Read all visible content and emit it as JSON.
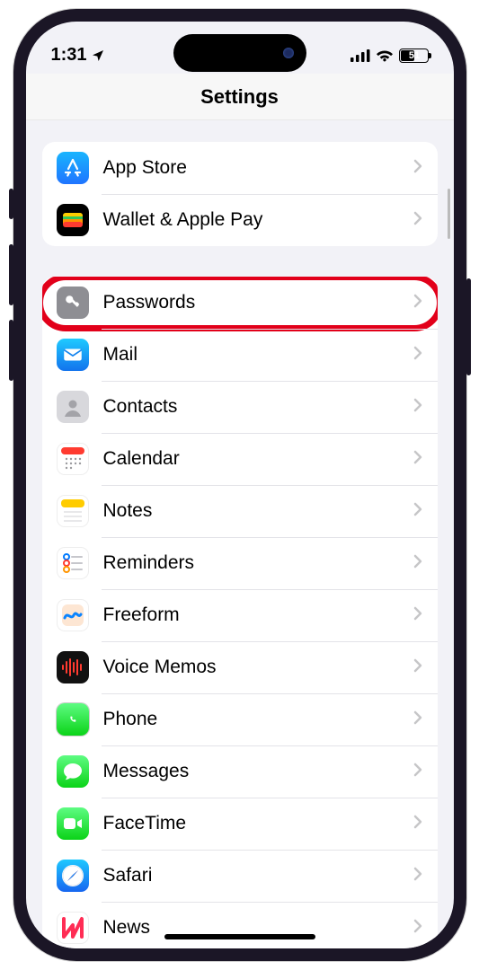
{
  "status": {
    "time": "1:31",
    "battery_pct": "51"
  },
  "nav": {
    "title": "Settings"
  },
  "groups": [
    {
      "id": "store",
      "rows": [
        {
          "name": "app-store",
          "label": "App Store",
          "icon": "appstore",
          "highlighted": false
        },
        {
          "name": "wallet",
          "label": "Wallet & Apple Pay",
          "icon": "wallet",
          "highlighted": false
        }
      ]
    },
    {
      "id": "apps",
      "rows": [
        {
          "name": "passwords",
          "label": "Passwords",
          "icon": "password",
          "highlighted": true
        },
        {
          "name": "mail",
          "label": "Mail",
          "icon": "mail"
        },
        {
          "name": "contacts",
          "label": "Contacts",
          "icon": "contacts"
        },
        {
          "name": "calendar",
          "label": "Calendar",
          "icon": "calendar"
        },
        {
          "name": "notes",
          "label": "Notes",
          "icon": "notes"
        },
        {
          "name": "reminders",
          "label": "Reminders",
          "icon": "reminders"
        },
        {
          "name": "freeform",
          "label": "Freeform",
          "icon": "freeform"
        },
        {
          "name": "voicememo",
          "label": "Voice Memos",
          "icon": "voicememo"
        },
        {
          "name": "phone",
          "label": "Phone",
          "icon": "phone"
        },
        {
          "name": "messages",
          "label": "Messages",
          "icon": "messages"
        },
        {
          "name": "facetime",
          "label": "FaceTime",
          "icon": "facetime"
        },
        {
          "name": "safari",
          "label": "Safari",
          "icon": "safari"
        },
        {
          "name": "news",
          "label": "News",
          "icon": "news"
        }
      ]
    }
  ],
  "icons": {
    "appstore": "<svg width='24' height='24' viewBox='0 0 24 24' fill='none' stroke='#fff' stroke-width='2.2' stroke-linecap='round'><path d='M12 3 L7 13'/><path d='M12 3 L17 13'/><path d='M4 17h5'/><path d='M15 17h5'/><path d='M6.3 20.5 L7.4 18.3'/><path d='M17.7 20.5 L16.6 18.3'/></svg>",
    "wallet": "<svg width='30' height='30' viewBox='0 0 30 30'><rect x='4' y='7' width='22' height='16' rx='3' fill='#3a3a3c'/><rect x='4' y='7' width='22' height='6' rx='3' fill='#ffcc00'/><rect x='4' y='11' width='22' height='5' fill='#34c759'/><rect x='4' y='14' width='22' height='5' fill='#ff9500'/><rect x='4' y='17' width='22' height='6' rx='3' fill='#ff3b30'/></svg>",
    "password": "<svg width='22' height='22' viewBox='0 0 24 24' fill='#fff'><circle cx='8' cy='8' r='4.5'/><rect x='9.5' y='9.5' width='3' height='11' transform='rotate(-45 9.5 9.5)'/><rect x='15' y='13' width='3' height='4' transform='rotate(-45 15 13)'/></svg>",
    "mail": "<svg width='26' height='26' viewBox='0 0 24 24' fill='#fff'><rect x='3' y='6' width='18' height='12' rx='2'/><path d='M3 7l9 6 9-6' fill='none' stroke='#1785ee' stroke-width='1.6'/></svg>",
    "contacts": "<svg width='30' height='30' viewBox='0 0 30 30'><rect x='3' y='3' width='24' height='24' rx='6' fill='#d8d8dc'/><circle cx='15' cy='12' r='4.5' fill='#a3a3a8'/><path d='M6 26c1.5-5 6-7 9-7s7.5 2 9 7' fill='#a3a3a8'/></svg>",
    "calendar": "<svg width='30' height='30' viewBox='0 0 30 30'><rect x='2' y='2' width='26' height='8' rx='4' fill='#ff3b30'/><g fill='#9a9a9e'><circle cx='8' cy='15' r='1.2'/><circle cx='13' cy='15' r='1.2'/><circle cx='18' cy='15' r='1.2'/><circle cx='23' cy='15' r='1.2'/><circle cx='8' cy='20' r='1.2'/><circle cx='13' cy='20' r='1.2'/><circle cx='18' cy='20' r='1.2'/><circle cx='23' cy='20' r='1.2'/><circle cx='8' cy='25' r='1.2'/><circle cx='13' cy='25' r='1.2'/></g></svg>",
    "notes": "<svg width='30' height='30' viewBox='0 0 30 30'><rect x='2' y='2' width='26' height='9' rx='4' fill='#ffcc00'/><line x1='5' y1='16' x2='25' y2='16' stroke='#d9d9de' stroke-width='1.3'/><line x1='5' y1='21' x2='25' y2='21' stroke='#d9d9de' stroke-width='1.3'/><line x1='5' y1='26' x2='25' y2='26' stroke='#d9d9de' stroke-width='1.3'/></svg>",
    "reminders": "<svg width='26' height='26' viewBox='0 0 26 26'><circle cx='6' cy='6' r='3' fill='none' stroke='#007aff' stroke-width='2'/><circle cx='6' cy='13' r='3' fill='none' stroke='#ff3b30' stroke-width='2'/><circle cx='6' cy='20' r='3' fill='none' stroke='#ff9500' stroke-width='2'/><line x1='12' y1='6' x2='23' y2='6' stroke='#c7c7cc' stroke-width='2' stroke-linecap='round'/><line x1='12' y1='13' x2='23' y2='13' stroke='#c7c7cc' stroke-width='2' stroke-linecap='round'/><line x1='12' y1='20' x2='23' y2='20' stroke='#c7c7cc' stroke-width='2' stroke-linecap='round'/></svg>",
    "freeform": "<svg width='30' height='30' viewBox='0 0 30 30'><rect x='3' y='3' width='24' height='24' rx='6' fill='#fde6d3'/><path d='M6 18c3-8 7 3 10-3s5 4 8-1' fill='none' stroke='#0a84ff' stroke-width='3' stroke-linecap='round'/></svg>",
    "voicememo": "<svg width='26' height='20' viewBox='0 0 26 20' fill='none' stroke='#ff3b30' stroke-width='2' stroke-linecap='round'><line x1='2' y1='8' x2='2' y2='12'/><line x1='6' y1='4' x2='6' y2='16'/><line x1='10' y1='1' x2='10' y2='19'/><line x1='14' y1='5' x2='14' y2='15'/><line x1='18' y1='2' x2='18' y2='18'/><line x1='22' y1='7' x2='22' y2='13'/></svg>",
    "phone": "<svg width='22' height='22' viewBox='0 0 24 24' fill='#fff'><path d='M6 2c-1 0-2 .8-2 2 0 9 7 16 16 16 1.2 0 2-1 2-2v-3c0-.8-.6-1.5-1.4-1.7l-3-.8c-.7-.2-1.4.1-1.8.7l-1 1.5c-2.6-1.3-4.7-3.4-6-6l1.5-1c.6-.4.9-1.1.7-1.8l-.8-3C10 2.6 9.3 2 8.5 2H6z'/></svg>",
    "messages": "<svg width='24' height='24' viewBox='0 0 24 24' fill='#fff'><path d='M12 3C6.5 3 2 6.8 2 11.5c0 2.5 1.3 4.7 3.4 6.2-.2 1.2-.8 2.6-1.7 3.6 1.9-.2 3.8-1 5.2-2 .9.2 2 .3 3.1.3 5.5 0 10-3.8 10-8.5S17.5 3 12 3z'/></svg>",
    "facetime": "<svg width='24' height='24' viewBox='0 0 24 24' fill='#fff'><rect x='2' y='6' width='13' height='12' rx='3'/><path d='M17 10l5-3v10l-5-3z'/></svg>",
    "safari": "<svg width='28' height='28' viewBox='0 0 28 28'><circle cx='14' cy='14' r='12' fill='#fff'/><circle cx='14' cy='14' r='11' fill='none' stroke='#d0d0d5' stroke-width='.5'/><path d='M20 8 L15 14 L8 20 L13 14 Z' fill='#ff3b30'/><path d='M20 8 L14 13 L8 20 L14 15 Z' fill='#0a84ff'/></svg>",
    "news": "<svg width='26' height='26' viewBox='0 0 26 26' fill='#ff2d55'><path d='M3 3v20l10-13v13L23 3v20' fill='none' stroke='#ff2d55' stroke-width='4' stroke-linejoin='round' stroke-linecap='round'/></svg>"
  }
}
